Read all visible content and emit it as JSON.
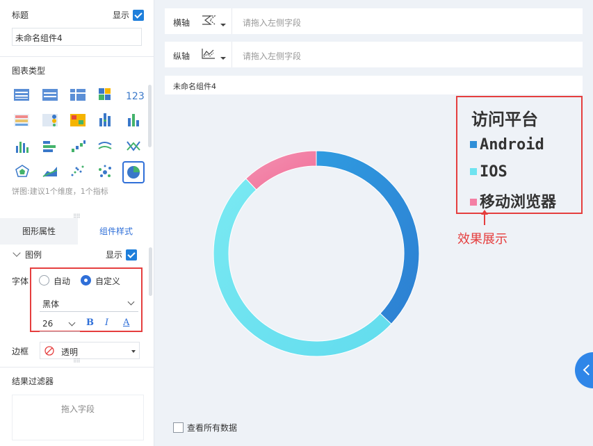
{
  "left_panel": {
    "title_label": "标题",
    "show_label": "显示",
    "component_name": "未命名组件4",
    "chart_type_label": "图表类型",
    "chart_hint": "饼图:建议1个维度，1个指标",
    "tabs": [
      "图形属性",
      "组件样式"
    ],
    "legend_label": "图例",
    "legend_show_label": "显示",
    "font_label": "字体",
    "font_mode_auto": "自动",
    "font_mode_custom": "自定义",
    "font_family": "黑体",
    "font_size": "26",
    "format_bold": "B",
    "format_italic": "I",
    "format_color": "A",
    "border_label": "边框",
    "border_value": "透明",
    "filter_label": "结果过滤器",
    "filter_placeholder": "拖入字段",
    "chart_type_icons": [
      "table-icon",
      "grouped-table-icon",
      "cross-table-icon",
      "color-block-icon",
      "number-icon",
      "kpi-list-icon",
      "kpi-dots-icon",
      "heatmap-icon",
      "stacked-bar-icon",
      "bar-chart-icon",
      "column-chart-icon",
      "horizontal-bar-icon",
      "step-icon",
      "line-chart-icon",
      "cross-line-icon",
      "radar-icon",
      "area-chart-icon",
      "scatter-icon",
      "bubble-icon",
      "pie-chart-icon"
    ]
  },
  "axes": {
    "x_label": "横轴",
    "y_label": "纵轴",
    "placeholder": "请拖入左侧字段"
  },
  "chart": {
    "component_title": "未命名组件4",
    "view_all_label": "查看所有数据"
  },
  "annotation": {
    "effect_label": "效果展示"
  },
  "chart_data": {
    "type": "pie",
    "donut": true,
    "legend_title": "访问平台",
    "legend_position": "top-right",
    "categories": [
      "Android",
      "IOS",
      "移动浏览器"
    ],
    "values": [
      37,
      51,
      12
    ],
    "colors": [
      "#2f8fd8",
      "#6fe3f0",
      "#f47fa4"
    ]
  }
}
